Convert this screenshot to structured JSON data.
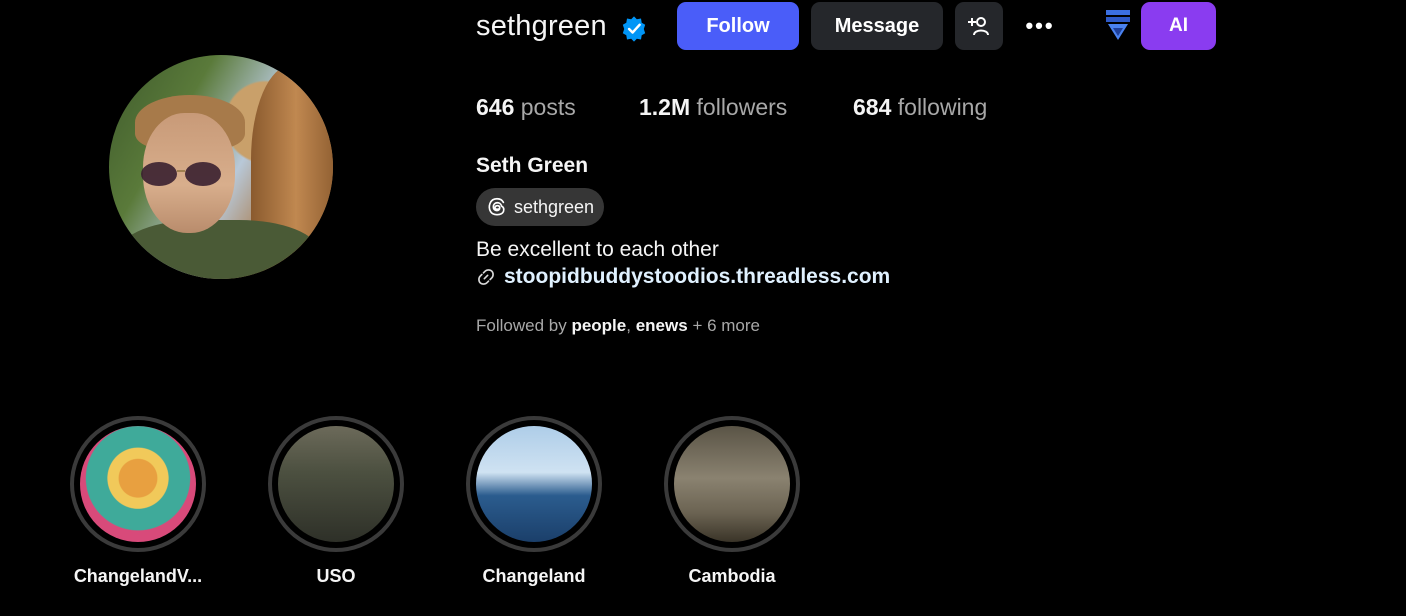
{
  "profile": {
    "username": "sethgreen",
    "full_name": "Seth Green",
    "threads_handle": "sethgreen",
    "bio": "Be excellent to each other",
    "link": "stoopidbuddystoodios.threadless.com",
    "verified": true,
    "avatar_icon": "profile-photo"
  },
  "actions": {
    "follow": "Follow",
    "message": "Message",
    "add_user_icon": "add-user-icon",
    "more": "•••",
    "ai": "AI"
  },
  "stats": {
    "posts_count": "646",
    "posts_label": "posts",
    "followers_count": "1.2M",
    "followers_label": "followers",
    "following_count": "684",
    "following_label": "following"
  },
  "followed_by": {
    "prefix": "Followed by",
    "user1": "people",
    "sep": ",",
    "user2": "enews",
    "more": "+ 6 more"
  },
  "highlights": [
    {
      "label": "ChangelandV..."
    },
    {
      "label": "USO"
    },
    {
      "label": "Changeland"
    },
    {
      "label": "Cambodia"
    }
  ],
  "colors": {
    "follow_button": "#4a5df9",
    "secondary_button": "#25272b",
    "ai_button": "#8a3cf0",
    "verified_badge": "#0095f6"
  }
}
